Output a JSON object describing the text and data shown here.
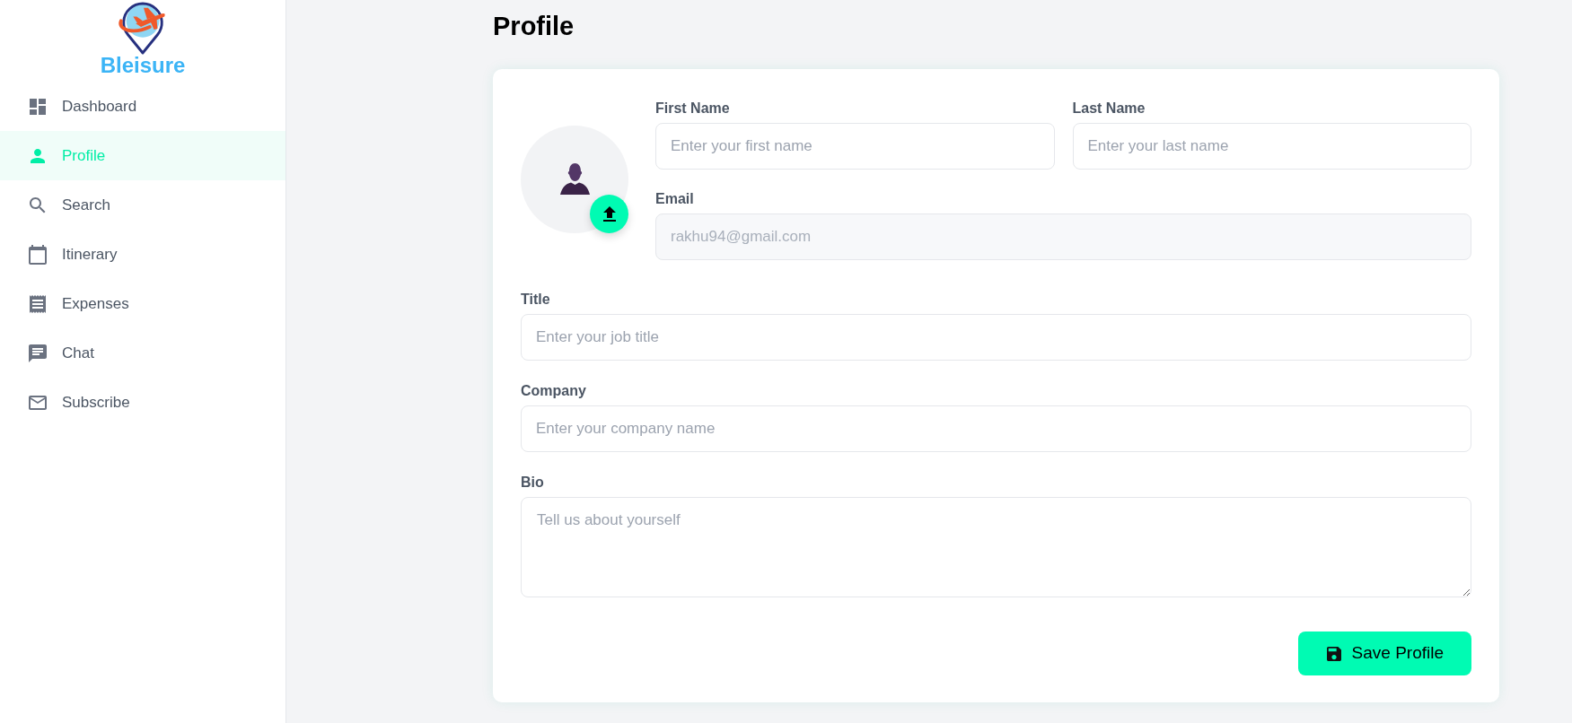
{
  "sidebar": {
    "logo_text": "Bleisure",
    "items": [
      {
        "label": "Dashboard",
        "selected": false
      },
      {
        "label": "Profile",
        "selected": true
      },
      {
        "label": "Search",
        "selected": false
      },
      {
        "label": "Itinerary",
        "selected": false
      },
      {
        "label": "Expenses",
        "selected": false
      },
      {
        "label": "Chat",
        "selected": false
      },
      {
        "label": "Subscribe",
        "selected": false
      }
    ]
  },
  "page_title": "Profile",
  "profile_card": {
    "top_fields": [
      {
        "kind": "input",
        "label": "First Name",
        "placeholder": "Enter your first name",
        "disabled": false
      },
      {
        "kind": "input",
        "label": "Last Name",
        "placeholder": "Enter your last name",
        "disabled": false
      },
      {
        "kind": "input",
        "label": "Email",
        "value": "rakhu94@gmail.com",
        "disabled": true
      }
    ],
    "fields": [
      {
        "kind": "input",
        "label": "Title",
        "placeholder": "Enter your job title",
        "disabled": false
      },
      {
        "kind": "input",
        "label": "Company",
        "placeholder": "Enter your company name",
        "disabled": false
      },
      {
        "kind": "textarea",
        "label": "Bio",
        "placeholder": "Tell us about yourself",
        "disabled": false
      }
    ],
    "save_button": {
      "label": "Save Profile"
    }
  }
}
